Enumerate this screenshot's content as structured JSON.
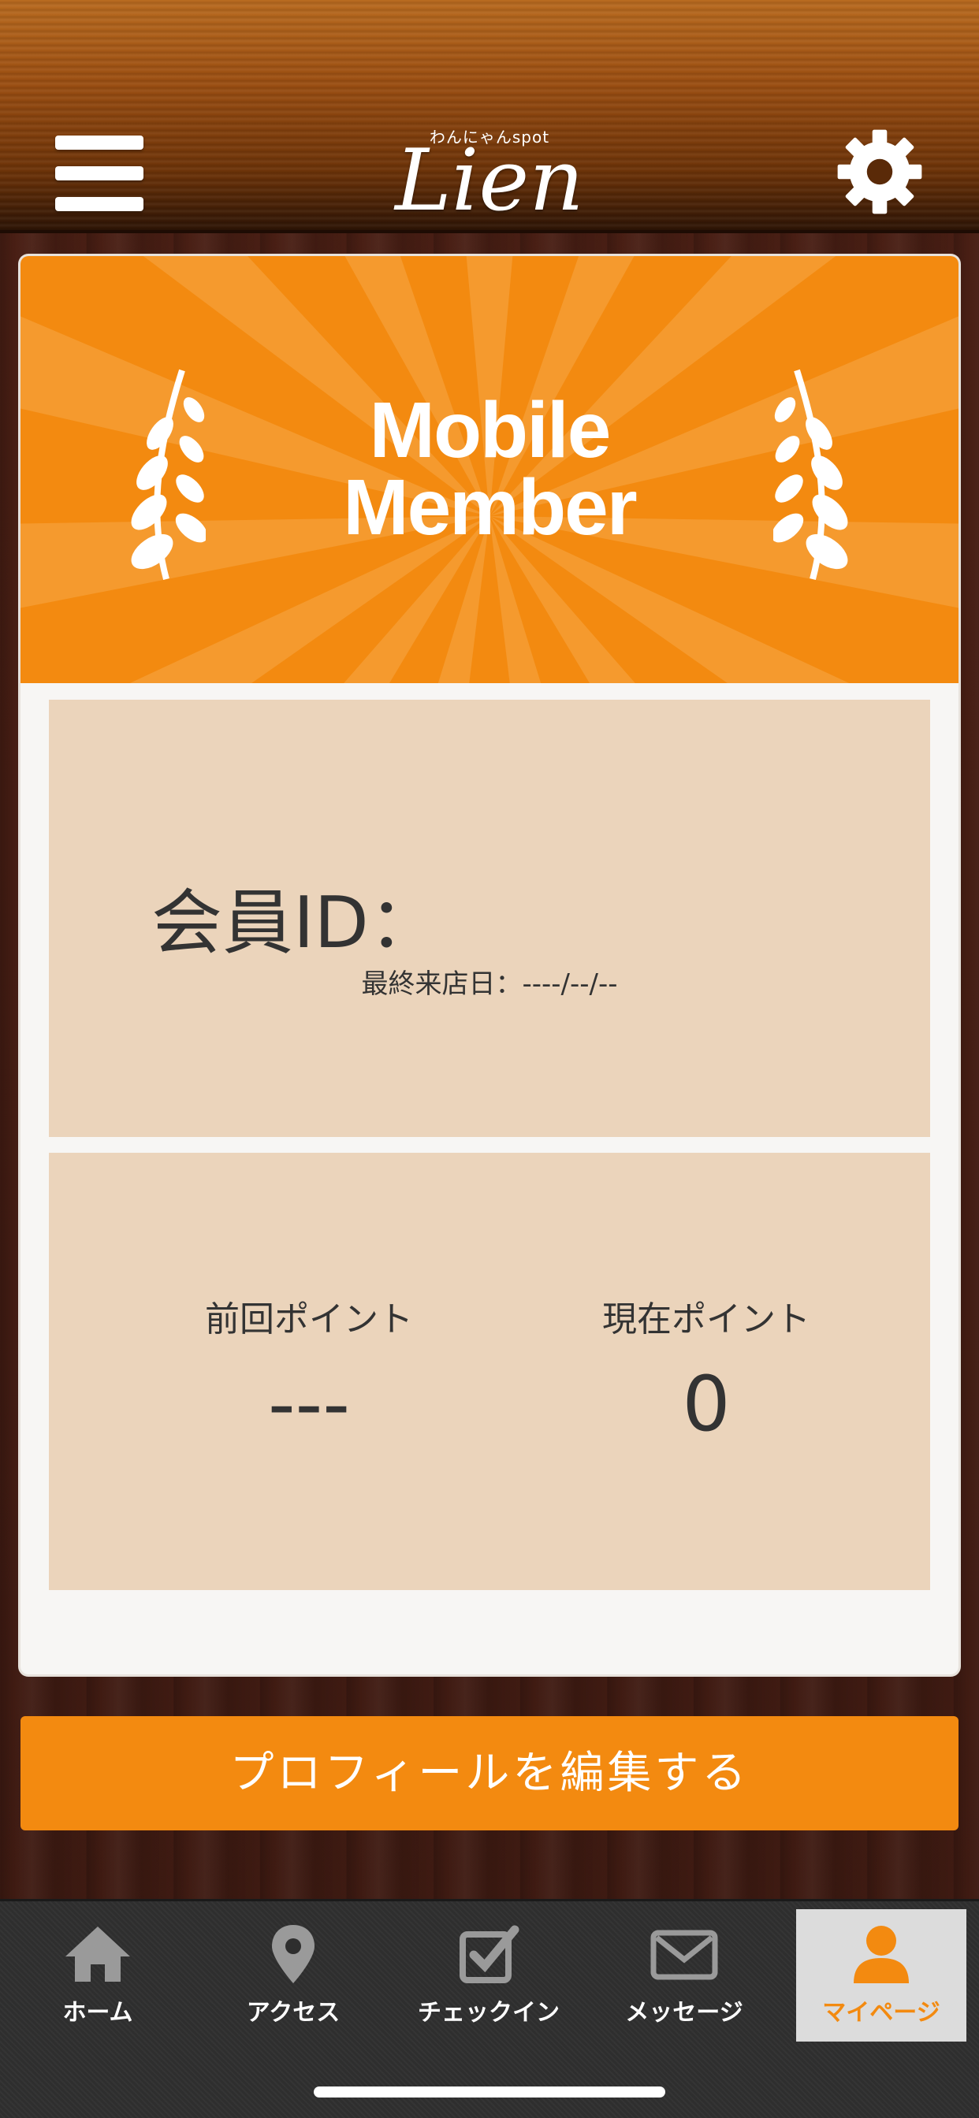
{
  "header": {
    "logo_small": "わんにゃんspot",
    "logo_main": "Lien"
  },
  "banner": {
    "title_line1": "Mobile",
    "title_line2": "Member"
  },
  "member": {
    "id_label": "会員ID：",
    "last_visit": "最終来店日：----/--/--"
  },
  "points": {
    "previous_label": "前回ポイント",
    "previous_value": "---",
    "current_label": "現在ポイント",
    "current_value": "0"
  },
  "edit_button_label": "プロフィールを編集する",
  "tabs": [
    {
      "label": "ホーム",
      "icon": "home-icon"
    },
    {
      "label": "アクセス",
      "icon": "map-pin-icon"
    },
    {
      "label": "チェックイン",
      "icon": "checkbox-icon"
    },
    {
      "label": "メッセージ",
      "icon": "envelope-icon"
    },
    {
      "label": "マイページ",
      "icon": "person-icon",
      "active": true
    }
  ],
  "colors": {
    "accent": "#f38a10",
    "panel": "#ebd4bb",
    "tabbar": "#2e2e2e"
  }
}
